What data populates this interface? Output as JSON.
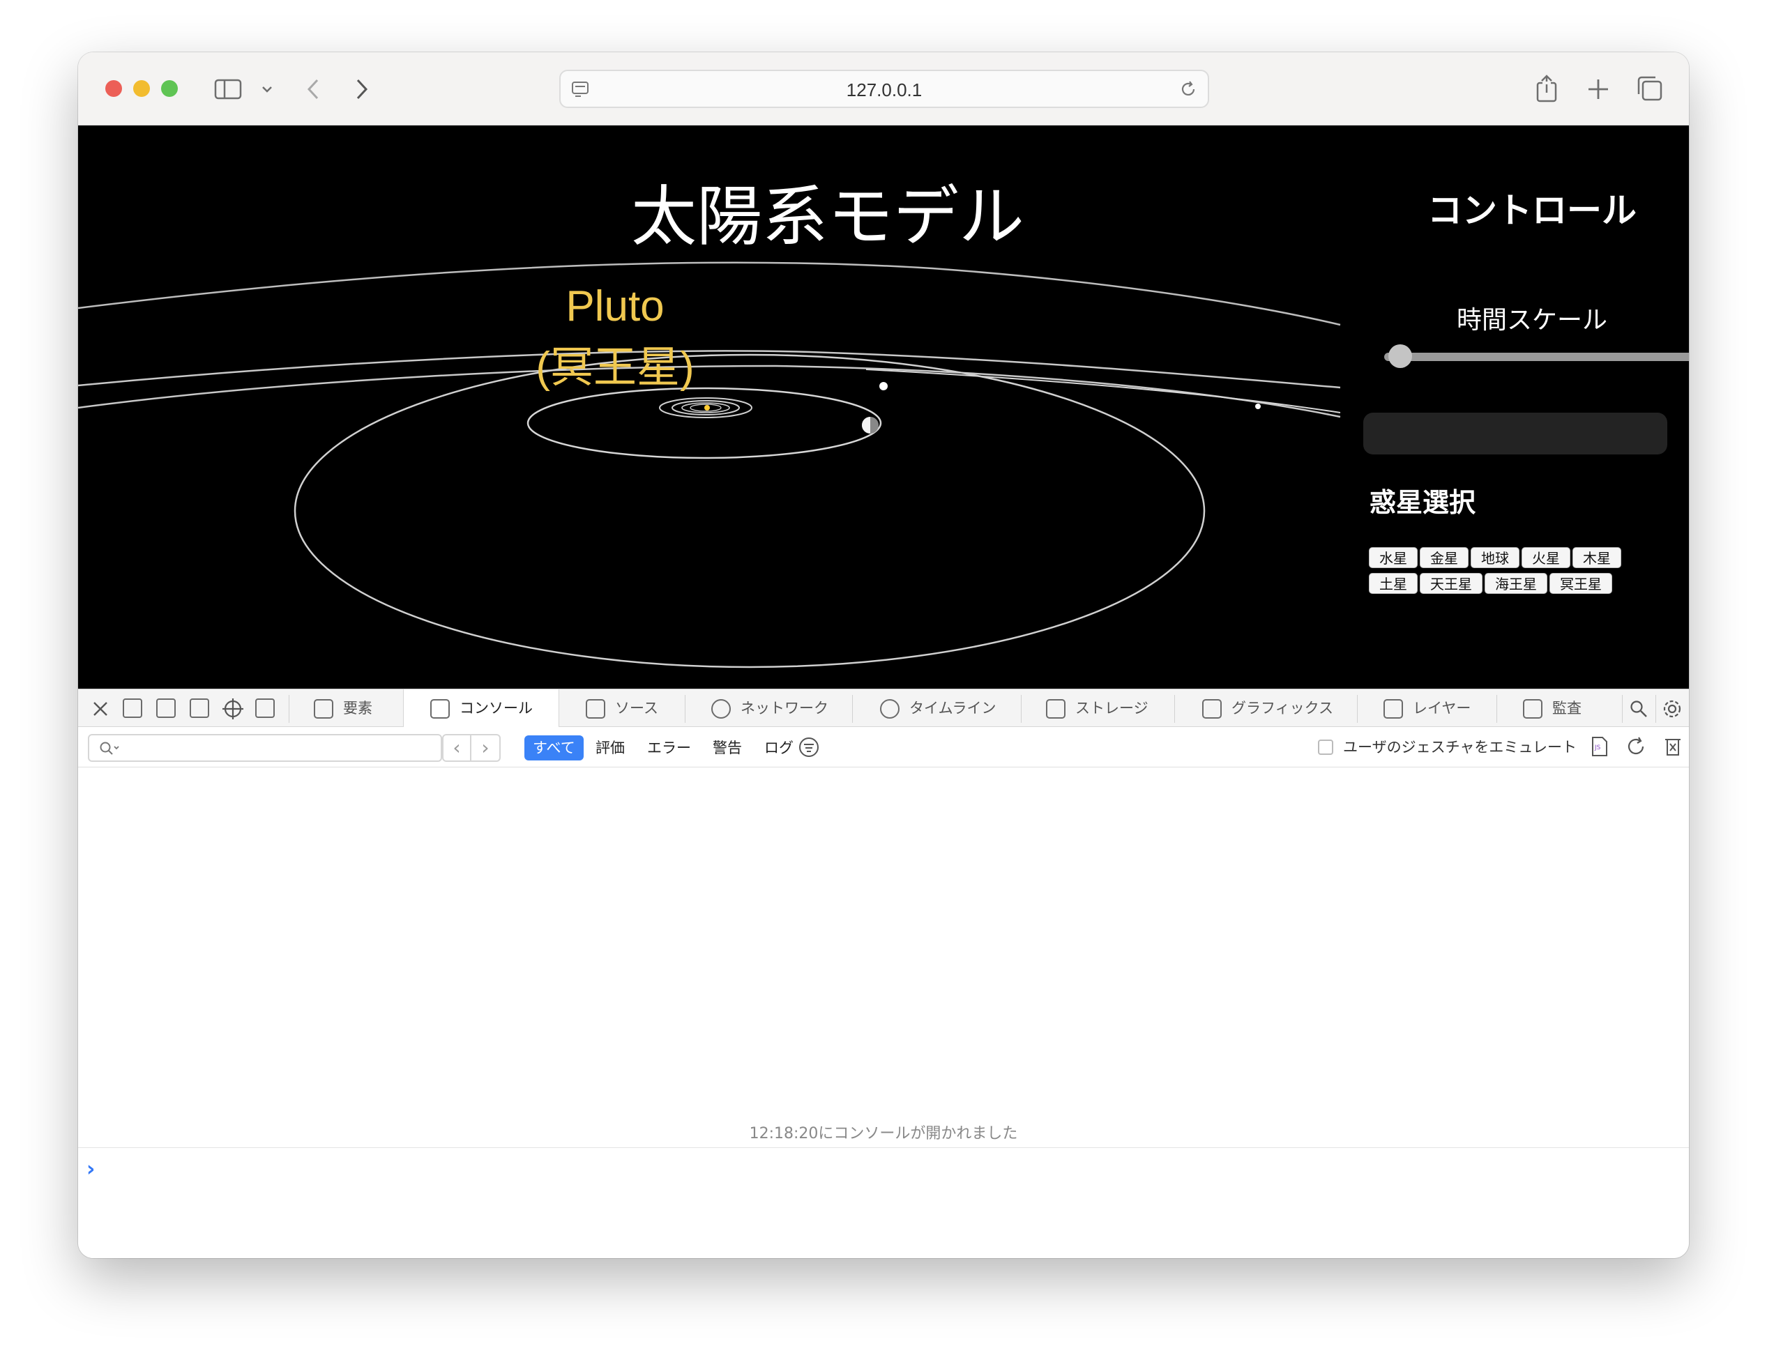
{
  "browser": {
    "url": "127.0.0.1"
  },
  "page": {
    "title": "太陽系モデル",
    "focused_planet_label": [
      "Pluto",
      "(冥王星)"
    ],
    "controls": {
      "title": "コントロール",
      "time_scale_label": "時間スケール",
      "time_scale_value": 0.02,
      "planet_select_title": "惑星選択",
      "planet_buttons": [
        "水星",
        "金星",
        "地球",
        "火星",
        "木星",
        "土星",
        "天王星",
        "海王星",
        "冥王星"
      ]
    }
  },
  "devtools": {
    "tabs": [
      "要素",
      "コンソール",
      "ソース",
      "ネットワーク",
      "タイムライン",
      "ストレージ",
      "グラフィックス",
      "レイヤー",
      "監査"
    ],
    "active_tab": "コンソール",
    "filters": [
      "すべて",
      "評価",
      "エラー",
      "警告",
      "ログ"
    ],
    "active_filter": "すべて",
    "emulate_gesture_label": "ユーザのジェスチャをエミュレート",
    "console_message": "12:18:20にコンソールが開かれました"
  },
  "colors": {
    "label_color": "#f0c850",
    "accent": "#3a82f7"
  }
}
